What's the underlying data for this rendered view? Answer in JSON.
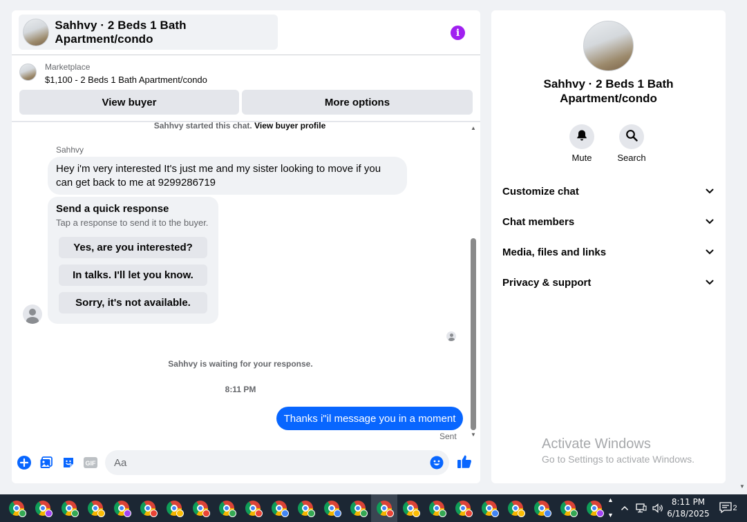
{
  "chat": {
    "title": "Sahhvy · 2 Beds 1 Bath Apartment/condo",
    "info_icon": "i",
    "listing": {
      "source": "Marketplace",
      "price_title": "$1,100 - 2 Beds 1 Bath Apartment/condo"
    },
    "actions": {
      "view_buyer": "View buyer",
      "more_options": "More options"
    },
    "started_text": "Sahhvy started this chat.",
    "view_profile_link": "View buyer profile",
    "sender_name": "Sahhvy",
    "incoming_message": "Hey i'm very interested It's just me and my sister looking to move if you can get back to me at 9299286719",
    "quick_response": {
      "title": "Send a quick response",
      "subtitle": "Tap a response to send it to the buyer.",
      "options": [
        "Yes, are you interested?",
        "In talks. I'll let you know.",
        "Sorry, it's not available."
      ]
    },
    "waiting_text": "Sahhvy is waiting for your response.",
    "timestamp": "8:11 PM",
    "outgoing_message": "Thanks i\"il message you in a moment",
    "sent_status": "Sent",
    "composer_placeholder": "Aa"
  },
  "panel": {
    "title": "Sahhvy · 2 Beds 1 Bath Apartment/condo",
    "mute_label": "Mute",
    "search_label": "Search",
    "sections": [
      "Customize chat",
      "Chat members",
      "Media, files and links",
      "Privacy & support"
    ]
  },
  "watermark": {
    "title": "Activate Windows",
    "subtitle": "Go to Settings to activate Windows."
  },
  "taskbar": {
    "app_count": 23,
    "profile_colors": [
      "#34a853",
      "#a142f4",
      "#34a853",
      "#fbbc04",
      "#a142f4",
      "#ea4335",
      "#fbbc04",
      "#ea4335",
      "#34a853",
      "#ea4335",
      "#4285f4",
      "#34a853",
      "#4285f4",
      "#34a853",
      "#ea4335",
      "#fbbc04",
      "#34a853",
      "#ea4335",
      "#4285f4",
      "#fbbc04",
      "#4285f4",
      "#34a853",
      "#a142f4"
    ],
    "active_index": 14,
    "time": "8:11 PM",
    "date": "6/18/2025",
    "notification_count": "2"
  },
  "colors": {
    "accent": "#0866ff",
    "info_purple": "#a020f0",
    "taskbar": "#1c2734"
  },
  "icons": [
    "info-icon",
    "plus-icon",
    "image-icon",
    "sticker-icon",
    "gif-icon",
    "emoji-icon",
    "like-icon",
    "bell-icon",
    "search-icon",
    "chevron-down-icon"
  ]
}
